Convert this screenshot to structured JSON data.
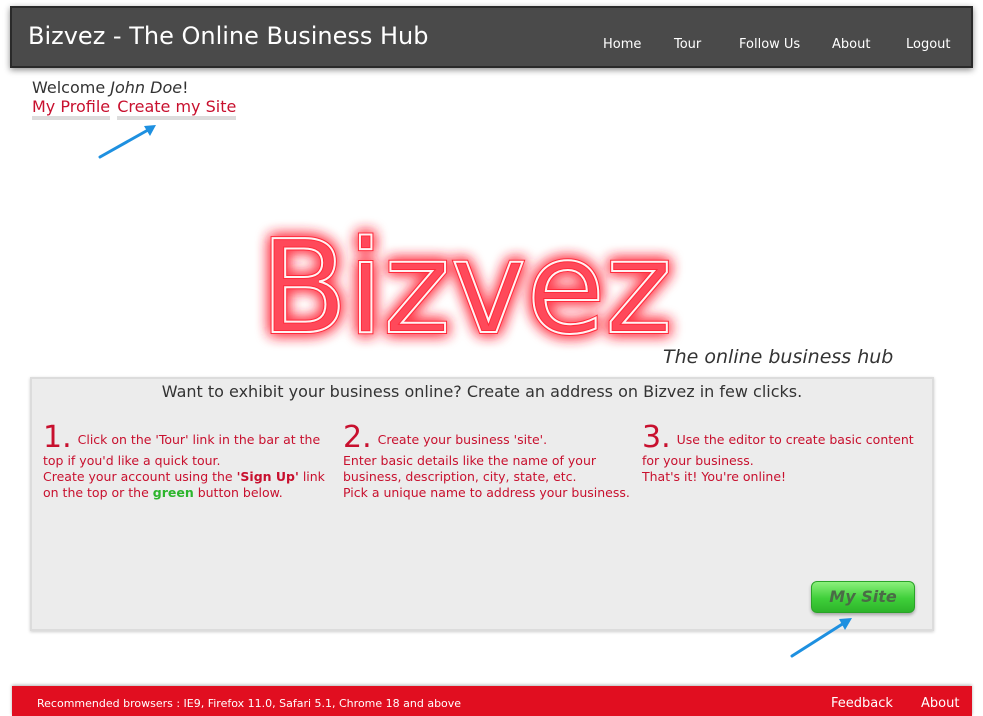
{
  "header": {
    "title": "Bizvez - The Online Business Hub",
    "nav": [
      "Home",
      "Tour",
      "Follow Us",
      "About",
      "Logout"
    ]
  },
  "welcome": {
    "prefix": "Welcome ",
    "user": "John Doe",
    "suffix": "!",
    "my_profile": "My Profile",
    "create_site": "Create my Site"
  },
  "logo": {
    "text": "Bizvez",
    "tagline": "The online business hub"
  },
  "panel": {
    "heading": "Want to exhibit your business online? Create an address on Bizvez in few clicks.",
    "steps": [
      {
        "num": "1.",
        "line1": "Click on the 'Tour' link in the bar at the top if you'd like a quick tour.",
        "line2_a": "Create your account using the ",
        "line2_b": "'Sign Up'",
        "line2_c": " link on the top or the ",
        "line2_d": "green",
        "line2_e": " button below."
      },
      {
        "num": "2.",
        "line1": "Create your business 'site'.",
        "line2": "Enter basic details like the name of your business, description, city, state, etc.",
        "line3": "Pick a unique name to address your business."
      },
      {
        "num": "3.",
        "line1": "Use the editor to create basic content for your business.",
        "line2": "That's it! You're online!"
      }
    ],
    "button": "My Site"
  },
  "footer": {
    "text": "Recommended browsers : IE9, Firefox 11.0, Safari 5.1, Chrome 18 and above",
    "feedback": "Feedback",
    "about": "About"
  },
  "colors": {
    "accent": "#c8102e",
    "footer": "#e10e20",
    "topbar": "#4a4a4a",
    "button": "#3fcf3a"
  }
}
